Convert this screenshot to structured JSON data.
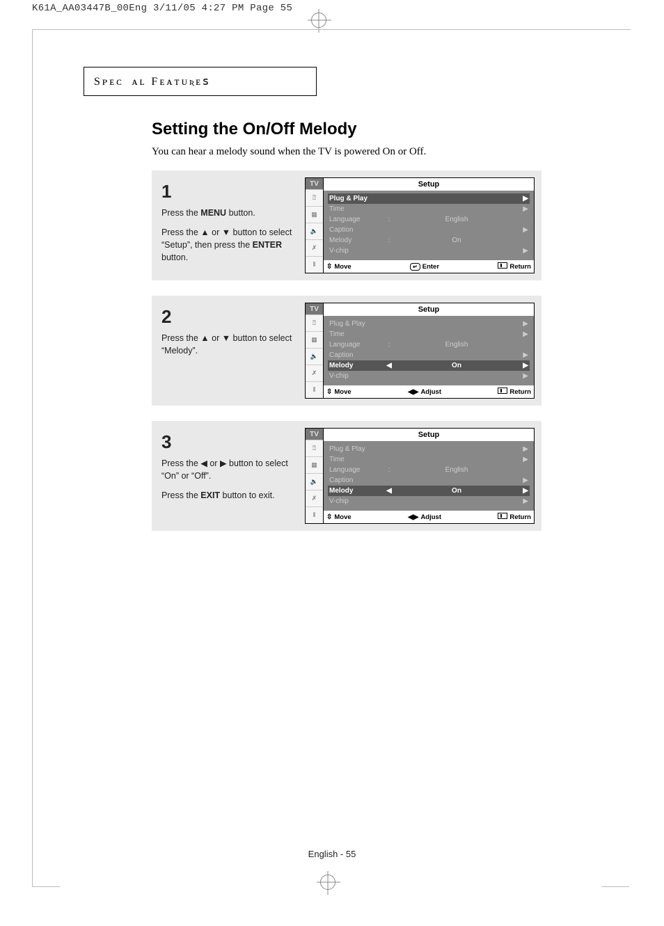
{
  "print_header": "K61A_AA03447B_00Eng  3/11/05  4:27 PM  Page 55",
  "section_label": "Sᴘᴇᴄɪᴀʟ Fᴇᴀᴛᴜʀᴇꜱ",
  "title": "Setting the On/Off Melody",
  "intro": "You can hear a melody sound when the TV is powered On or Off.",
  "footer": "English - 55",
  "steps": [
    {
      "num": "1",
      "para1_pre": "Press the ",
      "para1_bold": "MENU",
      "para1_post": " button.",
      "para2": "Press the ▲ or ▼ button to select “Setup”, then press the ",
      "para2_bold": "ENTER",
      "para2_post": " button.",
      "osd": {
        "title": "Setup",
        "rows": [
          {
            "label": "Plug & Play",
            "sep": "",
            "val": "",
            "arrow": "▶",
            "hl": true
          },
          {
            "label": "Time",
            "sep": "",
            "val": "",
            "arrow": "▶",
            "hl": false
          },
          {
            "label": "Language",
            "sep": ":",
            "val": "English",
            "arrow": "",
            "hl": false
          },
          {
            "label": "Caption",
            "sep": "",
            "val": "",
            "arrow": "▶",
            "hl": false
          },
          {
            "label": "Melody",
            "sep": ":",
            "val": "On",
            "arrow": "",
            "hl": false
          },
          {
            "label": "V-chip",
            "sep": "",
            "val": "",
            "arrow": "▶",
            "hl": false
          }
        ],
        "footer": [
          {
            "glyph": "⇳",
            "label": "Move"
          },
          {
            "glyph": "↵",
            "label": "Enter",
            "enter_style": true
          },
          {
            "glyph": "▭",
            "label": "Return",
            "return_style": true
          }
        ]
      }
    },
    {
      "num": "2",
      "para1_pre": "Press the ▲ or ▼ button to select “Melody”.",
      "para1_bold": "",
      "para1_post": "",
      "para2": "",
      "para2_bold": "",
      "para2_post": "",
      "osd": {
        "title": "Setup",
        "rows": [
          {
            "label": "Plug & Play",
            "sep": "",
            "val": "",
            "arrow": "▶",
            "hl": false
          },
          {
            "label": "Time",
            "sep": "",
            "val": "",
            "arrow": "▶",
            "hl": false
          },
          {
            "label": "Language",
            "sep": ":",
            "val": "English",
            "arrow": "",
            "hl": false
          },
          {
            "label": "Caption",
            "sep": "",
            "val": "",
            "arrow": "▶",
            "hl": false
          },
          {
            "label": "Melody",
            "sep": "◀",
            "val": "On",
            "arrow": "▶",
            "hl": true
          },
          {
            "label": "V-chip",
            "sep": "",
            "val": "",
            "arrow": "▶",
            "hl": false
          }
        ],
        "footer": [
          {
            "glyph": "⇳",
            "label": "Move"
          },
          {
            "glyph": "◀▶",
            "label": "Adjust"
          },
          {
            "glyph": "▭",
            "label": "Return",
            "return_style": true
          }
        ]
      }
    },
    {
      "num": "3",
      "para1_pre": "Press the ◀ or ▶ button to select “On” or “Off”.",
      "para1_bold": "",
      "para1_post": "",
      "para2": "Press the ",
      "para2_bold": "EXIT",
      "para2_post": " button to exit.",
      "osd": {
        "title": "Setup",
        "rows": [
          {
            "label": "Plug & Play",
            "sep": "",
            "val": "",
            "arrow": "▶",
            "hl": false
          },
          {
            "label": "Time",
            "sep": "",
            "val": "",
            "arrow": "▶",
            "hl": false
          },
          {
            "label": "Language",
            "sep": ":",
            "val": "English",
            "arrow": "",
            "hl": false
          },
          {
            "label": "Caption",
            "sep": "",
            "val": "",
            "arrow": "▶",
            "hl": false
          },
          {
            "label": "Melody",
            "sep": "◀",
            "val": "On",
            "arrow": "▶",
            "hl": true
          },
          {
            "label": "V-chip",
            "sep": "",
            "val": "",
            "arrow": "▶",
            "hl": false
          }
        ],
        "footer": [
          {
            "glyph": "⇳",
            "label": "Move"
          },
          {
            "glyph": "◀▶",
            "label": "Adjust"
          },
          {
            "glyph": "▭",
            "label": "Return",
            "return_style": true
          }
        ]
      }
    }
  ],
  "sidebar_tabs": [
    "TV",
    "⍰",
    "▦",
    "🔈",
    "✗",
    "⦀"
  ]
}
